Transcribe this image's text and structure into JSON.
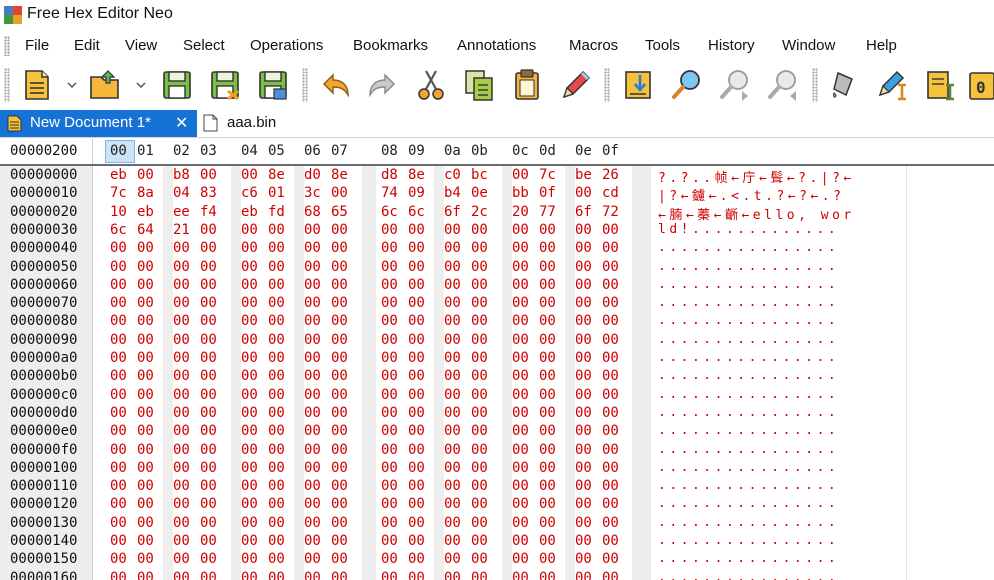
{
  "window": {
    "title": "Free Hex Editor Neo",
    "icon": "app-logo-icon",
    "icon_colors": [
      "#4d79c7",
      "#e0452f",
      "#3f9a3f",
      "#e8a22a"
    ]
  },
  "menu": [
    "File",
    "Edit",
    "View",
    "Select",
    "Operations",
    "Bookmarks",
    "Annotations",
    "Macros",
    "Tools",
    "History",
    "Window",
    "Help"
  ],
  "toolbar": {
    "buttons": [
      {
        "name": "new-document-icon",
        "dropdown": true
      },
      {
        "name": "open-folder-icon",
        "dropdown": true
      },
      {
        "name": "save-icon"
      },
      {
        "name": "save-as-icon"
      },
      {
        "name": "save-all-icon"
      },
      {
        "name": "undo-icon"
      },
      {
        "name": "redo-icon"
      },
      {
        "name": "cut-icon"
      },
      {
        "name": "copy-icon"
      },
      {
        "name": "paste-icon"
      },
      {
        "name": "edit-pencil-icon"
      },
      {
        "name": "go-to-icon"
      },
      {
        "name": "find-icon"
      },
      {
        "name": "find-next-icon"
      },
      {
        "name": "find-previous-icon"
      },
      {
        "name": "fill-icon"
      },
      {
        "name": "insert-pencil-icon"
      },
      {
        "name": "insert-mode-icon"
      },
      {
        "name": "overflow-icon"
      }
    ],
    "overflow_label": "0"
  },
  "tabs": [
    {
      "label": "New Document 1*",
      "active": true,
      "close": "✕"
    },
    {
      "label": "aaa.bin",
      "active": false
    }
  ],
  "hex": {
    "current_offset": "00000200",
    "columns": [
      "00",
      "01",
      "02",
      "03",
      "04",
      "05",
      "06",
      "07",
      "08",
      "09",
      "0a",
      "0b",
      "0c",
      "0d",
      "0e",
      "0f"
    ],
    "selected_column": "00",
    "text_color": "#d00000",
    "rows": [
      {
        "offset": "00000000",
        "bytes": [
          "eb",
          "00",
          "b8",
          "00",
          "00",
          "8e",
          "d0",
          "8e",
          "d8",
          "8e",
          "c0",
          "bc",
          "00",
          "7c",
          "be",
          "26"
        ],
        "ascii": "?.?..帧←庁←髶←?.|?←"
      },
      {
        "offset": "00000010",
        "bytes": [
          "7c",
          "8a",
          "04",
          "83",
          "c6",
          "01",
          "3c",
          "00",
          "74",
          "09",
          "b4",
          "0e",
          "bb",
          "0f",
          "00",
          "cd"
        ],
        "ascii": "|?←鑢←.<.t.?←?←.?"
      },
      {
        "offset": "00000020",
        "bytes": [
          "10",
          "eb",
          "ee",
          "f4",
          "eb",
          "fd",
          "68",
          "65",
          "6c",
          "6c",
          "6f",
          "2c",
          "20",
          "77",
          "6f",
          "72"
        ],
        "ascii": "←腩←蓁←齭←ello, wor"
      },
      {
        "offset": "00000030",
        "bytes": [
          "6c",
          "64",
          "21",
          "00",
          "00",
          "00",
          "00",
          "00",
          "00",
          "00",
          "00",
          "00",
          "00",
          "00",
          "00",
          "00"
        ],
        "ascii": "ld!............."
      },
      {
        "offset": "00000040",
        "bytes": [
          "00",
          "00",
          "00",
          "00",
          "00",
          "00",
          "00",
          "00",
          "00",
          "00",
          "00",
          "00",
          "00",
          "00",
          "00",
          "00"
        ],
        "ascii": "................"
      },
      {
        "offset": "00000050",
        "bytes": [
          "00",
          "00",
          "00",
          "00",
          "00",
          "00",
          "00",
          "00",
          "00",
          "00",
          "00",
          "00",
          "00",
          "00",
          "00",
          "00"
        ],
        "ascii": "................"
      },
      {
        "offset": "00000060",
        "bytes": [
          "00",
          "00",
          "00",
          "00",
          "00",
          "00",
          "00",
          "00",
          "00",
          "00",
          "00",
          "00",
          "00",
          "00",
          "00",
          "00"
        ],
        "ascii": "................"
      },
      {
        "offset": "00000070",
        "bytes": [
          "00",
          "00",
          "00",
          "00",
          "00",
          "00",
          "00",
          "00",
          "00",
          "00",
          "00",
          "00",
          "00",
          "00",
          "00",
          "00"
        ],
        "ascii": "................"
      },
      {
        "offset": "00000080",
        "bytes": [
          "00",
          "00",
          "00",
          "00",
          "00",
          "00",
          "00",
          "00",
          "00",
          "00",
          "00",
          "00",
          "00",
          "00",
          "00",
          "00"
        ],
        "ascii": "................"
      },
      {
        "offset": "00000090",
        "bytes": [
          "00",
          "00",
          "00",
          "00",
          "00",
          "00",
          "00",
          "00",
          "00",
          "00",
          "00",
          "00",
          "00",
          "00",
          "00",
          "00"
        ],
        "ascii": "................"
      },
      {
        "offset": "000000a0",
        "bytes": [
          "00",
          "00",
          "00",
          "00",
          "00",
          "00",
          "00",
          "00",
          "00",
          "00",
          "00",
          "00",
          "00",
          "00",
          "00",
          "00"
        ],
        "ascii": "................"
      },
      {
        "offset": "000000b0",
        "bytes": [
          "00",
          "00",
          "00",
          "00",
          "00",
          "00",
          "00",
          "00",
          "00",
          "00",
          "00",
          "00",
          "00",
          "00",
          "00",
          "00"
        ],
        "ascii": "................"
      },
      {
        "offset": "000000c0",
        "bytes": [
          "00",
          "00",
          "00",
          "00",
          "00",
          "00",
          "00",
          "00",
          "00",
          "00",
          "00",
          "00",
          "00",
          "00",
          "00",
          "00"
        ],
        "ascii": "................"
      },
      {
        "offset": "000000d0",
        "bytes": [
          "00",
          "00",
          "00",
          "00",
          "00",
          "00",
          "00",
          "00",
          "00",
          "00",
          "00",
          "00",
          "00",
          "00",
          "00",
          "00"
        ],
        "ascii": "................"
      },
      {
        "offset": "000000e0",
        "bytes": [
          "00",
          "00",
          "00",
          "00",
          "00",
          "00",
          "00",
          "00",
          "00",
          "00",
          "00",
          "00",
          "00",
          "00",
          "00",
          "00"
        ],
        "ascii": "................"
      },
      {
        "offset": "000000f0",
        "bytes": [
          "00",
          "00",
          "00",
          "00",
          "00",
          "00",
          "00",
          "00",
          "00",
          "00",
          "00",
          "00",
          "00",
          "00",
          "00",
          "00"
        ],
        "ascii": "................"
      },
      {
        "offset": "00000100",
        "bytes": [
          "00",
          "00",
          "00",
          "00",
          "00",
          "00",
          "00",
          "00",
          "00",
          "00",
          "00",
          "00",
          "00",
          "00",
          "00",
          "00"
        ],
        "ascii": "................"
      },
      {
        "offset": "00000110",
        "bytes": [
          "00",
          "00",
          "00",
          "00",
          "00",
          "00",
          "00",
          "00",
          "00",
          "00",
          "00",
          "00",
          "00",
          "00",
          "00",
          "00"
        ],
        "ascii": "................"
      },
      {
        "offset": "00000120",
        "bytes": [
          "00",
          "00",
          "00",
          "00",
          "00",
          "00",
          "00",
          "00",
          "00",
          "00",
          "00",
          "00",
          "00",
          "00",
          "00",
          "00"
        ],
        "ascii": "................"
      },
      {
        "offset": "00000130",
        "bytes": [
          "00",
          "00",
          "00",
          "00",
          "00",
          "00",
          "00",
          "00",
          "00",
          "00",
          "00",
          "00",
          "00",
          "00",
          "00",
          "00"
        ],
        "ascii": "................"
      },
      {
        "offset": "00000140",
        "bytes": [
          "00",
          "00",
          "00",
          "00",
          "00",
          "00",
          "00",
          "00",
          "00",
          "00",
          "00",
          "00",
          "00",
          "00",
          "00",
          "00"
        ],
        "ascii": "................"
      },
      {
        "offset": "00000150",
        "bytes": [
          "00",
          "00",
          "00",
          "00",
          "00",
          "00",
          "00",
          "00",
          "00",
          "00",
          "00",
          "00",
          "00",
          "00",
          "00",
          "00"
        ],
        "ascii": "................"
      },
      {
        "offset": "00000160",
        "bytes": [
          "00",
          "00",
          "00",
          "00",
          "00",
          "00",
          "00",
          "00",
          "00",
          "00",
          "00",
          "00",
          "00",
          "00",
          "00",
          "00"
        ],
        "ascii": "................"
      }
    ]
  }
}
